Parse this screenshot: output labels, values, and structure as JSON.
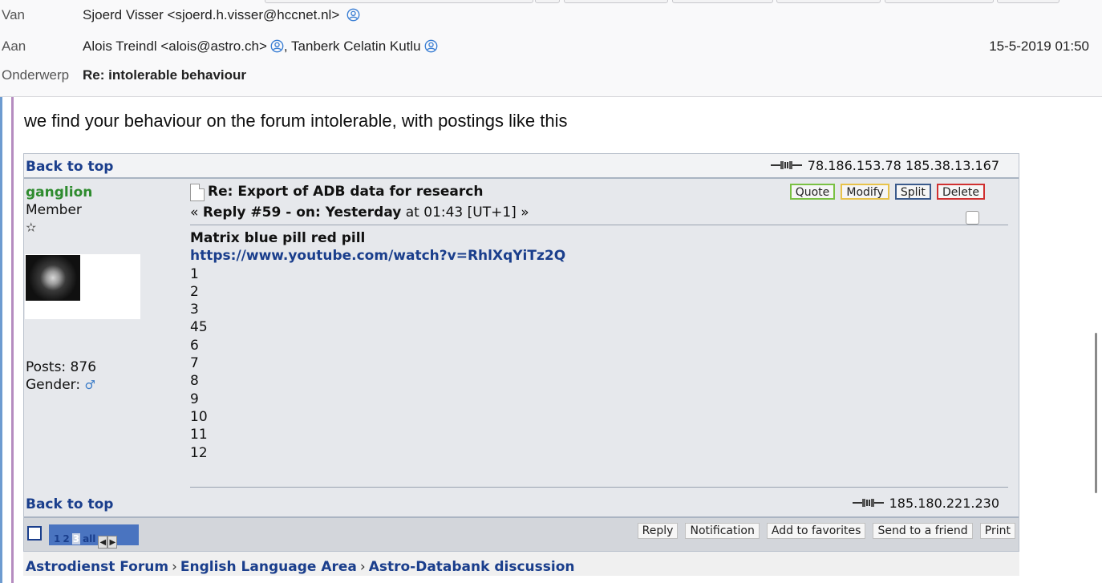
{
  "header": {
    "from_label": "Van",
    "from_value": "Sjoerd Visser <sjoerd.h.visser@hccnet.nl>",
    "to_label": "Aan",
    "to_value_1": "Alois Treindl <alois@astro.ch>",
    "to_sep": ",",
    "to_value_2": "Tanberk Celatin Kutlu",
    "date": "15-5-2019 01:50",
    "subject_label": "Onderwerp",
    "subject": "Re: intolerable behaviour"
  },
  "body": {
    "intro": "we find your behaviour on the forum intolerable, with postings like this"
  },
  "forum": {
    "back_to_top": "Back to top",
    "top_ip": "78.186.153.78 185.38.13.167",
    "bottom_ip": "185.180.221.230",
    "poster": {
      "name": "ganglion",
      "rank": "Member",
      "star": "✫",
      "posts": "Posts: 876",
      "gender_label": "Gender:",
      "gender_icon": "♂"
    },
    "post": {
      "title": "Re: Export of ADB data for research",
      "meta_prefix": "« ",
      "meta_bold": "Reply #59 - on: Yesterday",
      "meta_rest": " at 01:43 [UT+1] »",
      "heading": "Matrix blue pill red pill",
      "link": "https://www.youtube.com/watch?v=RhlXqYiTz2Q",
      "lines": [
        "1",
        "2",
        "3",
        "45",
        "6",
        "7",
        "8",
        "9",
        "10",
        "11",
        "12"
      ]
    },
    "mod_buttons": {
      "quote": "Quote",
      "modify": "Modify",
      "split": "Split",
      "delete": "Delete"
    },
    "pager": {
      "p1": "1",
      "p2": "2",
      "p3": "3",
      "all": "all"
    },
    "actions": {
      "reply": "Reply",
      "notification": "Notification",
      "favorites": "Add to favorites",
      "send": "Send to a friend",
      "print": "Print"
    },
    "breadcrumb": {
      "c1": "Astrodienst Forum",
      "c2": "English Language Area",
      "c3": "Astro-Databank discussion",
      "sep": "›"
    }
  },
  "colors": {
    "link": "#1a3e8c",
    "poster_name": "#2e8b2e",
    "quote_bar": "#b58cc0",
    "quote_btn": "#7ac143",
    "modify_btn": "#e8c34a",
    "split_btn": "#3a5a8c",
    "delete_btn": "#d03030"
  }
}
